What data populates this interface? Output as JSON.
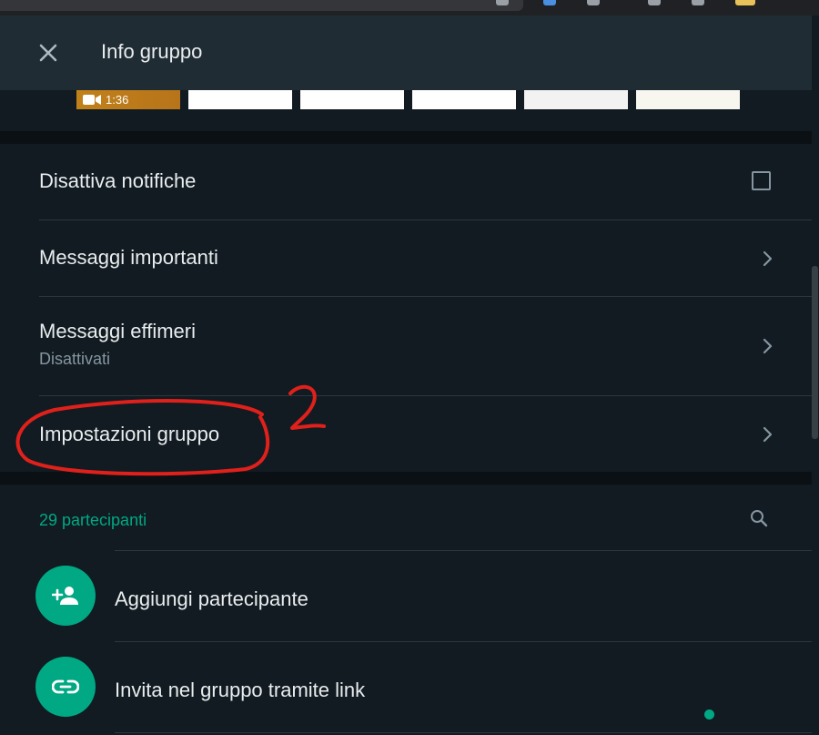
{
  "header": {
    "title": "Info gruppo"
  },
  "media": {
    "video_duration": "1:36"
  },
  "settings": {
    "mute": {
      "label": "Disattiva notifiche",
      "checked": false
    },
    "starred": {
      "label": "Messaggi importanti"
    },
    "ephemeral": {
      "label": "Messaggi effimeri",
      "value": "Disattivati"
    },
    "group_settings": {
      "label": "Impostazioni gruppo"
    }
  },
  "participants": {
    "count_label": "29 partecipanti",
    "add_label": "Aggiungi partecipante",
    "invite_label": "Invita nel gruppo tramite link"
  },
  "annotation": {
    "number": "2",
    "color": "#e0201b"
  },
  "colors": {
    "accent": "#00a884",
    "background": "#111b21",
    "header": "#202c33"
  }
}
